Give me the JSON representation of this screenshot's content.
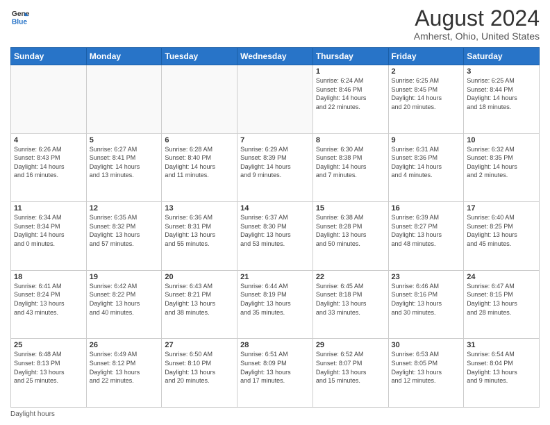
{
  "header": {
    "logo_line1": "General",
    "logo_line2": "Blue",
    "main_title": "August 2024",
    "subtitle": "Amherst, Ohio, United States"
  },
  "days_of_week": [
    "Sunday",
    "Monday",
    "Tuesday",
    "Wednesday",
    "Thursday",
    "Friday",
    "Saturday"
  ],
  "footer": {
    "note": "Daylight hours"
  },
  "weeks": [
    [
      {
        "day": "",
        "info": ""
      },
      {
        "day": "",
        "info": ""
      },
      {
        "day": "",
        "info": ""
      },
      {
        "day": "",
        "info": ""
      },
      {
        "day": "1",
        "info": "Sunrise: 6:24 AM\nSunset: 8:46 PM\nDaylight: 14 hours\nand 22 minutes."
      },
      {
        "day": "2",
        "info": "Sunrise: 6:25 AM\nSunset: 8:45 PM\nDaylight: 14 hours\nand 20 minutes."
      },
      {
        "day": "3",
        "info": "Sunrise: 6:25 AM\nSunset: 8:44 PM\nDaylight: 14 hours\nand 18 minutes."
      }
    ],
    [
      {
        "day": "4",
        "info": "Sunrise: 6:26 AM\nSunset: 8:43 PM\nDaylight: 14 hours\nand 16 minutes."
      },
      {
        "day": "5",
        "info": "Sunrise: 6:27 AM\nSunset: 8:41 PM\nDaylight: 14 hours\nand 13 minutes."
      },
      {
        "day": "6",
        "info": "Sunrise: 6:28 AM\nSunset: 8:40 PM\nDaylight: 14 hours\nand 11 minutes."
      },
      {
        "day": "7",
        "info": "Sunrise: 6:29 AM\nSunset: 8:39 PM\nDaylight: 14 hours\nand 9 minutes."
      },
      {
        "day": "8",
        "info": "Sunrise: 6:30 AM\nSunset: 8:38 PM\nDaylight: 14 hours\nand 7 minutes."
      },
      {
        "day": "9",
        "info": "Sunrise: 6:31 AM\nSunset: 8:36 PM\nDaylight: 14 hours\nand 4 minutes."
      },
      {
        "day": "10",
        "info": "Sunrise: 6:32 AM\nSunset: 8:35 PM\nDaylight: 14 hours\nand 2 minutes."
      }
    ],
    [
      {
        "day": "11",
        "info": "Sunrise: 6:34 AM\nSunset: 8:34 PM\nDaylight: 14 hours\nand 0 minutes."
      },
      {
        "day": "12",
        "info": "Sunrise: 6:35 AM\nSunset: 8:32 PM\nDaylight: 13 hours\nand 57 minutes."
      },
      {
        "day": "13",
        "info": "Sunrise: 6:36 AM\nSunset: 8:31 PM\nDaylight: 13 hours\nand 55 minutes."
      },
      {
        "day": "14",
        "info": "Sunrise: 6:37 AM\nSunset: 8:30 PM\nDaylight: 13 hours\nand 53 minutes."
      },
      {
        "day": "15",
        "info": "Sunrise: 6:38 AM\nSunset: 8:28 PM\nDaylight: 13 hours\nand 50 minutes."
      },
      {
        "day": "16",
        "info": "Sunrise: 6:39 AM\nSunset: 8:27 PM\nDaylight: 13 hours\nand 48 minutes."
      },
      {
        "day": "17",
        "info": "Sunrise: 6:40 AM\nSunset: 8:25 PM\nDaylight: 13 hours\nand 45 minutes."
      }
    ],
    [
      {
        "day": "18",
        "info": "Sunrise: 6:41 AM\nSunset: 8:24 PM\nDaylight: 13 hours\nand 43 minutes."
      },
      {
        "day": "19",
        "info": "Sunrise: 6:42 AM\nSunset: 8:22 PM\nDaylight: 13 hours\nand 40 minutes."
      },
      {
        "day": "20",
        "info": "Sunrise: 6:43 AM\nSunset: 8:21 PM\nDaylight: 13 hours\nand 38 minutes."
      },
      {
        "day": "21",
        "info": "Sunrise: 6:44 AM\nSunset: 8:19 PM\nDaylight: 13 hours\nand 35 minutes."
      },
      {
        "day": "22",
        "info": "Sunrise: 6:45 AM\nSunset: 8:18 PM\nDaylight: 13 hours\nand 33 minutes."
      },
      {
        "day": "23",
        "info": "Sunrise: 6:46 AM\nSunset: 8:16 PM\nDaylight: 13 hours\nand 30 minutes."
      },
      {
        "day": "24",
        "info": "Sunrise: 6:47 AM\nSunset: 8:15 PM\nDaylight: 13 hours\nand 28 minutes."
      }
    ],
    [
      {
        "day": "25",
        "info": "Sunrise: 6:48 AM\nSunset: 8:13 PM\nDaylight: 13 hours\nand 25 minutes."
      },
      {
        "day": "26",
        "info": "Sunrise: 6:49 AM\nSunset: 8:12 PM\nDaylight: 13 hours\nand 22 minutes."
      },
      {
        "day": "27",
        "info": "Sunrise: 6:50 AM\nSunset: 8:10 PM\nDaylight: 13 hours\nand 20 minutes."
      },
      {
        "day": "28",
        "info": "Sunrise: 6:51 AM\nSunset: 8:09 PM\nDaylight: 13 hours\nand 17 minutes."
      },
      {
        "day": "29",
        "info": "Sunrise: 6:52 AM\nSunset: 8:07 PM\nDaylight: 13 hours\nand 15 minutes."
      },
      {
        "day": "30",
        "info": "Sunrise: 6:53 AM\nSunset: 8:05 PM\nDaylight: 13 hours\nand 12 minutes."
      },
      {
        "day": "31",
        "info": "Sunrise: 6:54 AM\nSunset: 8:04 PM\nDaylight: 13 hours\nand 9 minutes."
      }
    ]
  ]
}
